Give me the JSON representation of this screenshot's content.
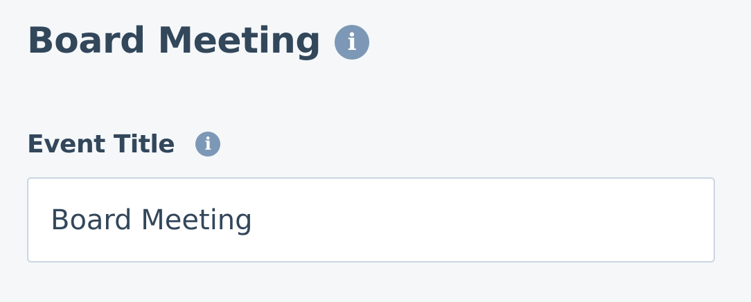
{
  "header": {
    "title": "Board Meeting",
    "info_icon": "info-circle-icon",
    "info_glyph": "i"
  },
  "form": {
    "event_title": {
      "label": "Event Title",
      "info_icon": "info-circle-icon",
      "info_glyph": "i",
      "value": "Board Meeting",
      "placeholder": ""
    }
  },
  "colors": {
    "text_primary": "#33475b",
    "icon": "#7c98b6",
    "background": "#f5f7f9",
    "input_border": "#cbd6e2",
    "input_background": "#ffffff"
  }
}
